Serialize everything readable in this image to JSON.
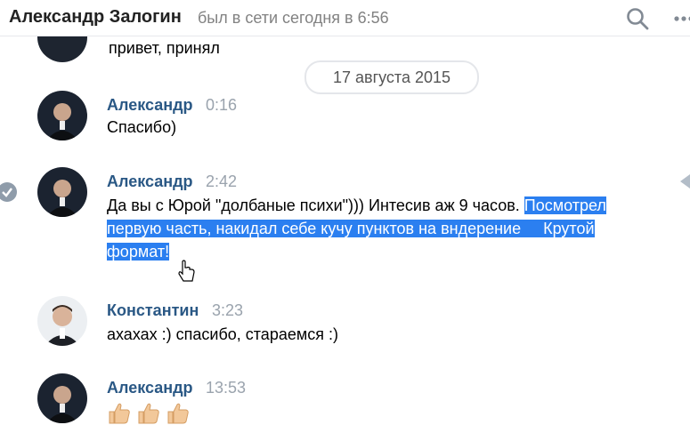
{
  "header": {
    "contact_name": "Александр Залогин",
    "status": "был в сети сегодня в 6:56",
    "search_icon": "search-icon",
    "more_icon": "more-icon"
  },
  "previous_message": {
    "text": "привет, принял"
  },
  "date_separator": "17 августа 2015",
  "messages": [
    {
      "author": "Александр",
      "time": "0:16",
      "text": "Спасибо)"
    },
    {
      "author": "Александр",
      "time": "2:42",
      "text_line1_plain": "Да вы с Юрой \"долбаные психи\"))) Интесив аж 9 часов.",
      "text_line1_selected": "Посмотрел",
      "text_line2_a": "первую часть, накидал себе кучу пунктов на вндерение",
      "text_line2_b": "Крутой",
      "text_line3": "формат!",
      "selected": true
    },
    {
      "author": "Константин",
      "time": "3:23",
      "text": "ахахах :) спасибо, стараемся :)"
    },
    {
      "author": "Александр",
      "time": "13:53",
      "emoji": [
        "thumbs-up",
        "thumbs-up",
        "thumbs-up"
      ]
    }
  ],
  "colors": {
    "author": "#2a5885",
    "selection": "#2b7ff0",
    "time": "#9aa3ad"
  }
}
